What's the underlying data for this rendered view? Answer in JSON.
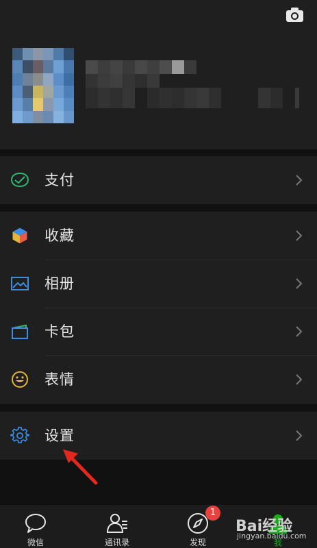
{
  "menu": {
    "pay": "支付",
    "favorites": "收藏",
    "album": "相册",
    "cards": "卡包",
    "stickers": "表情",
    "settings": "设置"
  },
  "tabs": {
    "chats": "微信",
    "contacts": "通讯录",
    "discover": "发现",
    "me": "我"
  },
  "badges": {
    "discover": "1"
  },
  "watermark": {
    "brand": "Bai经验",
    "url": "jingyan.baidu.com"
  },
  "colors": {
    "background": "#111111",
    "panel": "#1f1f1f",
    "active_tab": "#1aad19",
    "badge": "#e64340",
    "annotation_arrow": "#e5281e"
  },
  "icons": {
    "camera": "camera-icon",
    "pay": "wallet-icon",
    "favorites": "cube-icon",
    "album": "picture-icon",
    "cards": "card-icon",
    "stickers": "smiley-icon",
    "settings": "gear-icon"
  }
}
